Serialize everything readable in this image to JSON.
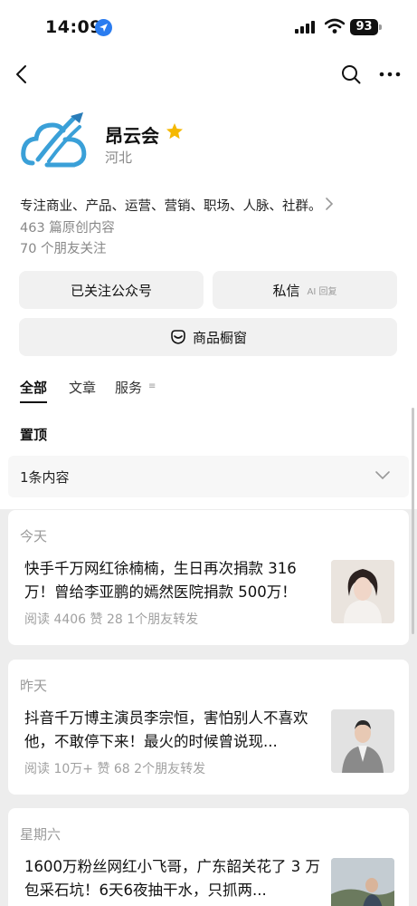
{
  "status_bar": {
    "time": "14:09",
    "battery": "93"
  },
  "account": {
    "name": "昂云会",
    "region": "河北",
    "bio": "专注商业、产品、运营、营销、职场、人脉、社群。",
    "original_count": "463 篇原创内容",
    "friends_following": "70 个朋友关注"
  },
  "buttons": {
    "follow": "已关注公众号",
    "message": "私信",
    "message_sub": "AI 回复",
    "shop": "商品橱窗"
  },
  "tabs": [
    {
      "label": "全部",
      "active": true
    },
    {
      "label": "文章"
    },
    {
      "label": "服务"
    }
  ],
  "pinned": {
    "label": "置顶",
    "content": "1条内容"
  },
  "articles": [
    {
      "day": "今天",
      "title": "快手千万网红徐楠楠，生日再次捐款 316 万！曾给李亚鹏的嫣然医院捐款 500万！",
      "meta": "阅读 4406  赞 28  1个朋友转发"
    },
    {
      "day": "昨天",
      "title": "抖音千万博主演员李宗恒，害怕别人不喜欢他，不敢停下来！最火的时候曾说现...",
      "meta": "阅读 10万+  赞 68  2个朋友转发"
    },
    {
      "day": "星期六",
      "title": "1600万粉丝网红小飞哥，广东韶关花了 3 万包采石坑！6天6夜抽干水，只抓两...",
      "meta": ""
    }
  ],
  "colors": {
    "accent_blue": "#2a7cf0",
    "star": "#f5b800",
    "logo_blue": "#3aa0d8"
  }
}
